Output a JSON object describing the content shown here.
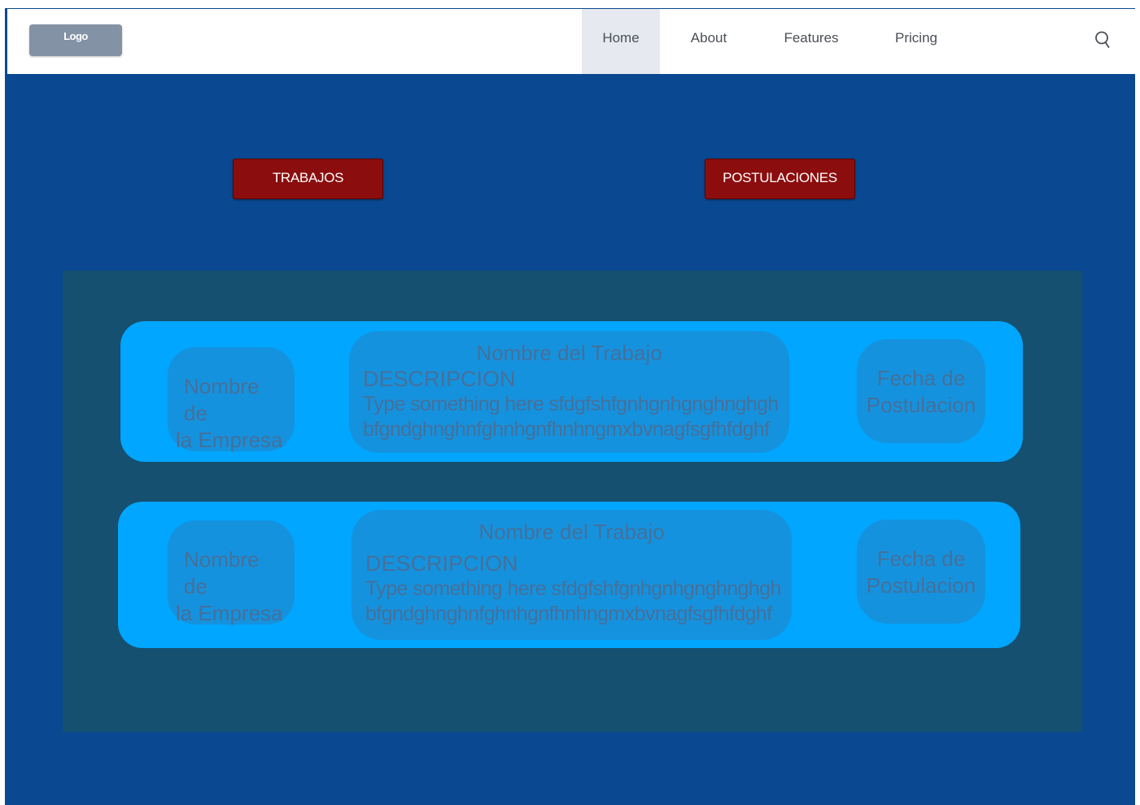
{
  "navbar": {
    "logo": "Logo",
    "items": [
      {
        "label": "Home",
        "active": true
      },
      {
        "label": "About",
        "active": false
      },
      {
        "label": "Features",
        "active": false
      },
      {
        "label": "Pricing",
        "active": false
      }
    ],
    "search_icon": "search-icon"
  },
  "actions": {
    "trabajos": "TRABAJOS",
    "postulaciones": "POSTULACIONES"
  },
  "cards": [
    {
      "company_line1": "Nombre de",
      "company_line2": "la Empresa",
      "job_title": "Nombre del Trabajo",
      "desc_label": "DESCRIPCION",
      "desc_line1": "Type something here sfdgfshfgnhgnhgnghnghgh",
      "desc_line2": "bfgndghnghnfghnhgnfhnhngmxbvnagfsgfhfdghf",
      "date_line1": "Fecha de",
      "date_line2": "Postulacion"
    },
    {
      "company_line1": "Nombre de",
      "company_line2": "la Empresa",
      "job_title": "Nombre del Trabajo",
      "desc_label": "DESCRIPCION",
      "desc_line1": "Type something here sfdgfshfgnhgnhgnghnghgh",
      "desc_line2": "bfgndghnghnfghnhgnfhnhngmxbvnagfsgfhfdghf",
      "date_line1": "Fecha de",
      "date_line2": "Postulacion"
    }
  ],
  "colors": {
    "page_background": "#0a4891",
    "navbar_background": "#ffffff",
    "nav_active_background": "#e6e9f0",
    "logo_background": "#8492a6",
    "action_button": "#8b0d0d",
    "panel_background": "#155070",
    "card_background": "#00a6ff",
    "pill_background": "#1592de",
    "pill_text": "#46709a"
  }
}
